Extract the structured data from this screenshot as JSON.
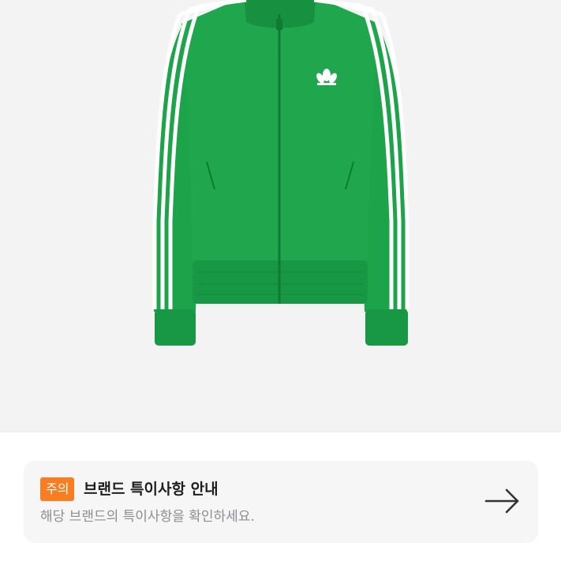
{
  "product": {
    "image_icon": "green-track-jacket-image",
    "brand_logo_icon": "trefoil-logo-icon",
    "colors": {
      "jacket": "#1da34a",
      "stripes": "#ffffff",
      "background": "#f3f3f3"
    }
  },
  "notice": {
    "badge": "주의",
    "title": "브랜드 특이사항 안내",
    "description": "해당 브랜드의 특이사항을 확인하세요.",
    "arrow_icon": "arrow-right-icon",
    "badge_color": "#fa7d22"
  }
}
